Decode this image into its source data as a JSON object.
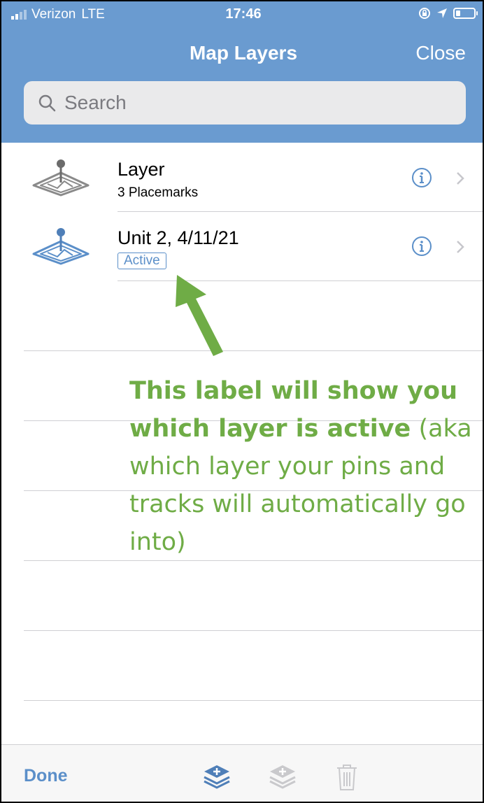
{
  "status_bar": {
    "carrier": "Verizon",
    "network": "LTE",
    "time": "17:46"
  },
  "nav": {
    "title": "Map Layers",
    "close_label": "Close"
  },
  "search": {
    "placeholder": "Search",
    "value": ""
  },
  "layers": [
    {
      "title": "Layer",
      "subtitle": "3 Placemarks",
      "icon": "map-layer-icon",
      "icon_color": "#8a8a8a",
      "active": false
    },
    {
      "title": "Unit 2, 4/11/21",
      "badge": "Active",
      "icon": "map-layer-icon",
      "icon_color": "#5b8fc9",
      "active": true
    }
  ],
  "annotation": {
    "bold_text": "This label will show you which layer is active",
    "normal_text": "(aka which layer your pins and tracks will automatically go into)",
    "color": "#6fac46"
  },
  "toolbar": {
    "done_label": "Done",
    "icons": [
      "add-layer-icon",
      "duplicate-layer-icon",
      "trash-icon"
    ]
  },
  "colors": {
    "header": "#6a9bd0",
    "accent": "#5b8fc9",
    "annotation": "#6fac46"
  }
}
